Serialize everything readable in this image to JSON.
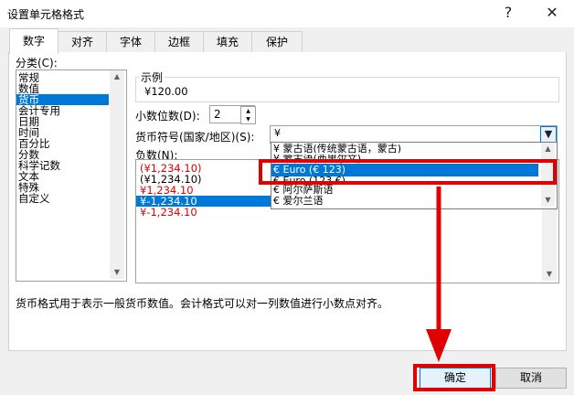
{
  "window": {
    "title": "设置单元格格式",
    "help": "?",
    "close": "✕"
  },
  "tabs": [
    "数字",
    "对齐",
    "字体",
    "边框",
    "填充",
    "保护"
  ],
  "category": {
    "label": "分类(C):",
    "items": [
      "常规",
      "数值",
      "货币",
      "会计专用",
      "日期",
      "时间",
      "百分比",
      "分数",
      "科学记数",
      "文本",
      "特殊",
      "自定义"
    ],
    "selected_index": 2
  },
  "sample": {
    "title": "示例",
    "value": "¥120.00"
  },
  "decimal": {
    "label": "小数位数(D):",
    "value": "2"
  },
  "currency": {
    "label": "货币符号(国家/地区)(S):",
    "value": "¥",
    "options": [
      "¥ 蒙古语(传统蒙古语，蒙古)",
      "¥ 蒙古语(西里尔文)",
      "€ Euro (€ 123)",
      "€ Euro (123 €)",
      "€ 阿尔萨斯语",
      "€ 爱尔兰语"
    ],
    "selected_index": 2
  },
  "negative": {
    "label": "负数(N):",
    "items": [
      "(¥1,234.10)",
      "(¥1,234.10)",
      "¥1,234.10",
      "¥-1,234.10",
      "¥-1,234.10"
    ],
    "red_indices": [
      0,
      2,
      4
    ],
    "selected_index": 3
  },
  "description": "货币格式用于表示一般货币数值。会计格式可以对一列数值进行小数点对齐。",
  "buttons": {
    "ok": "确定",
    "cancel": "取消"
  },
  "annotation_color": "#e00000",
  "accent_color": "#0078d7"
}
